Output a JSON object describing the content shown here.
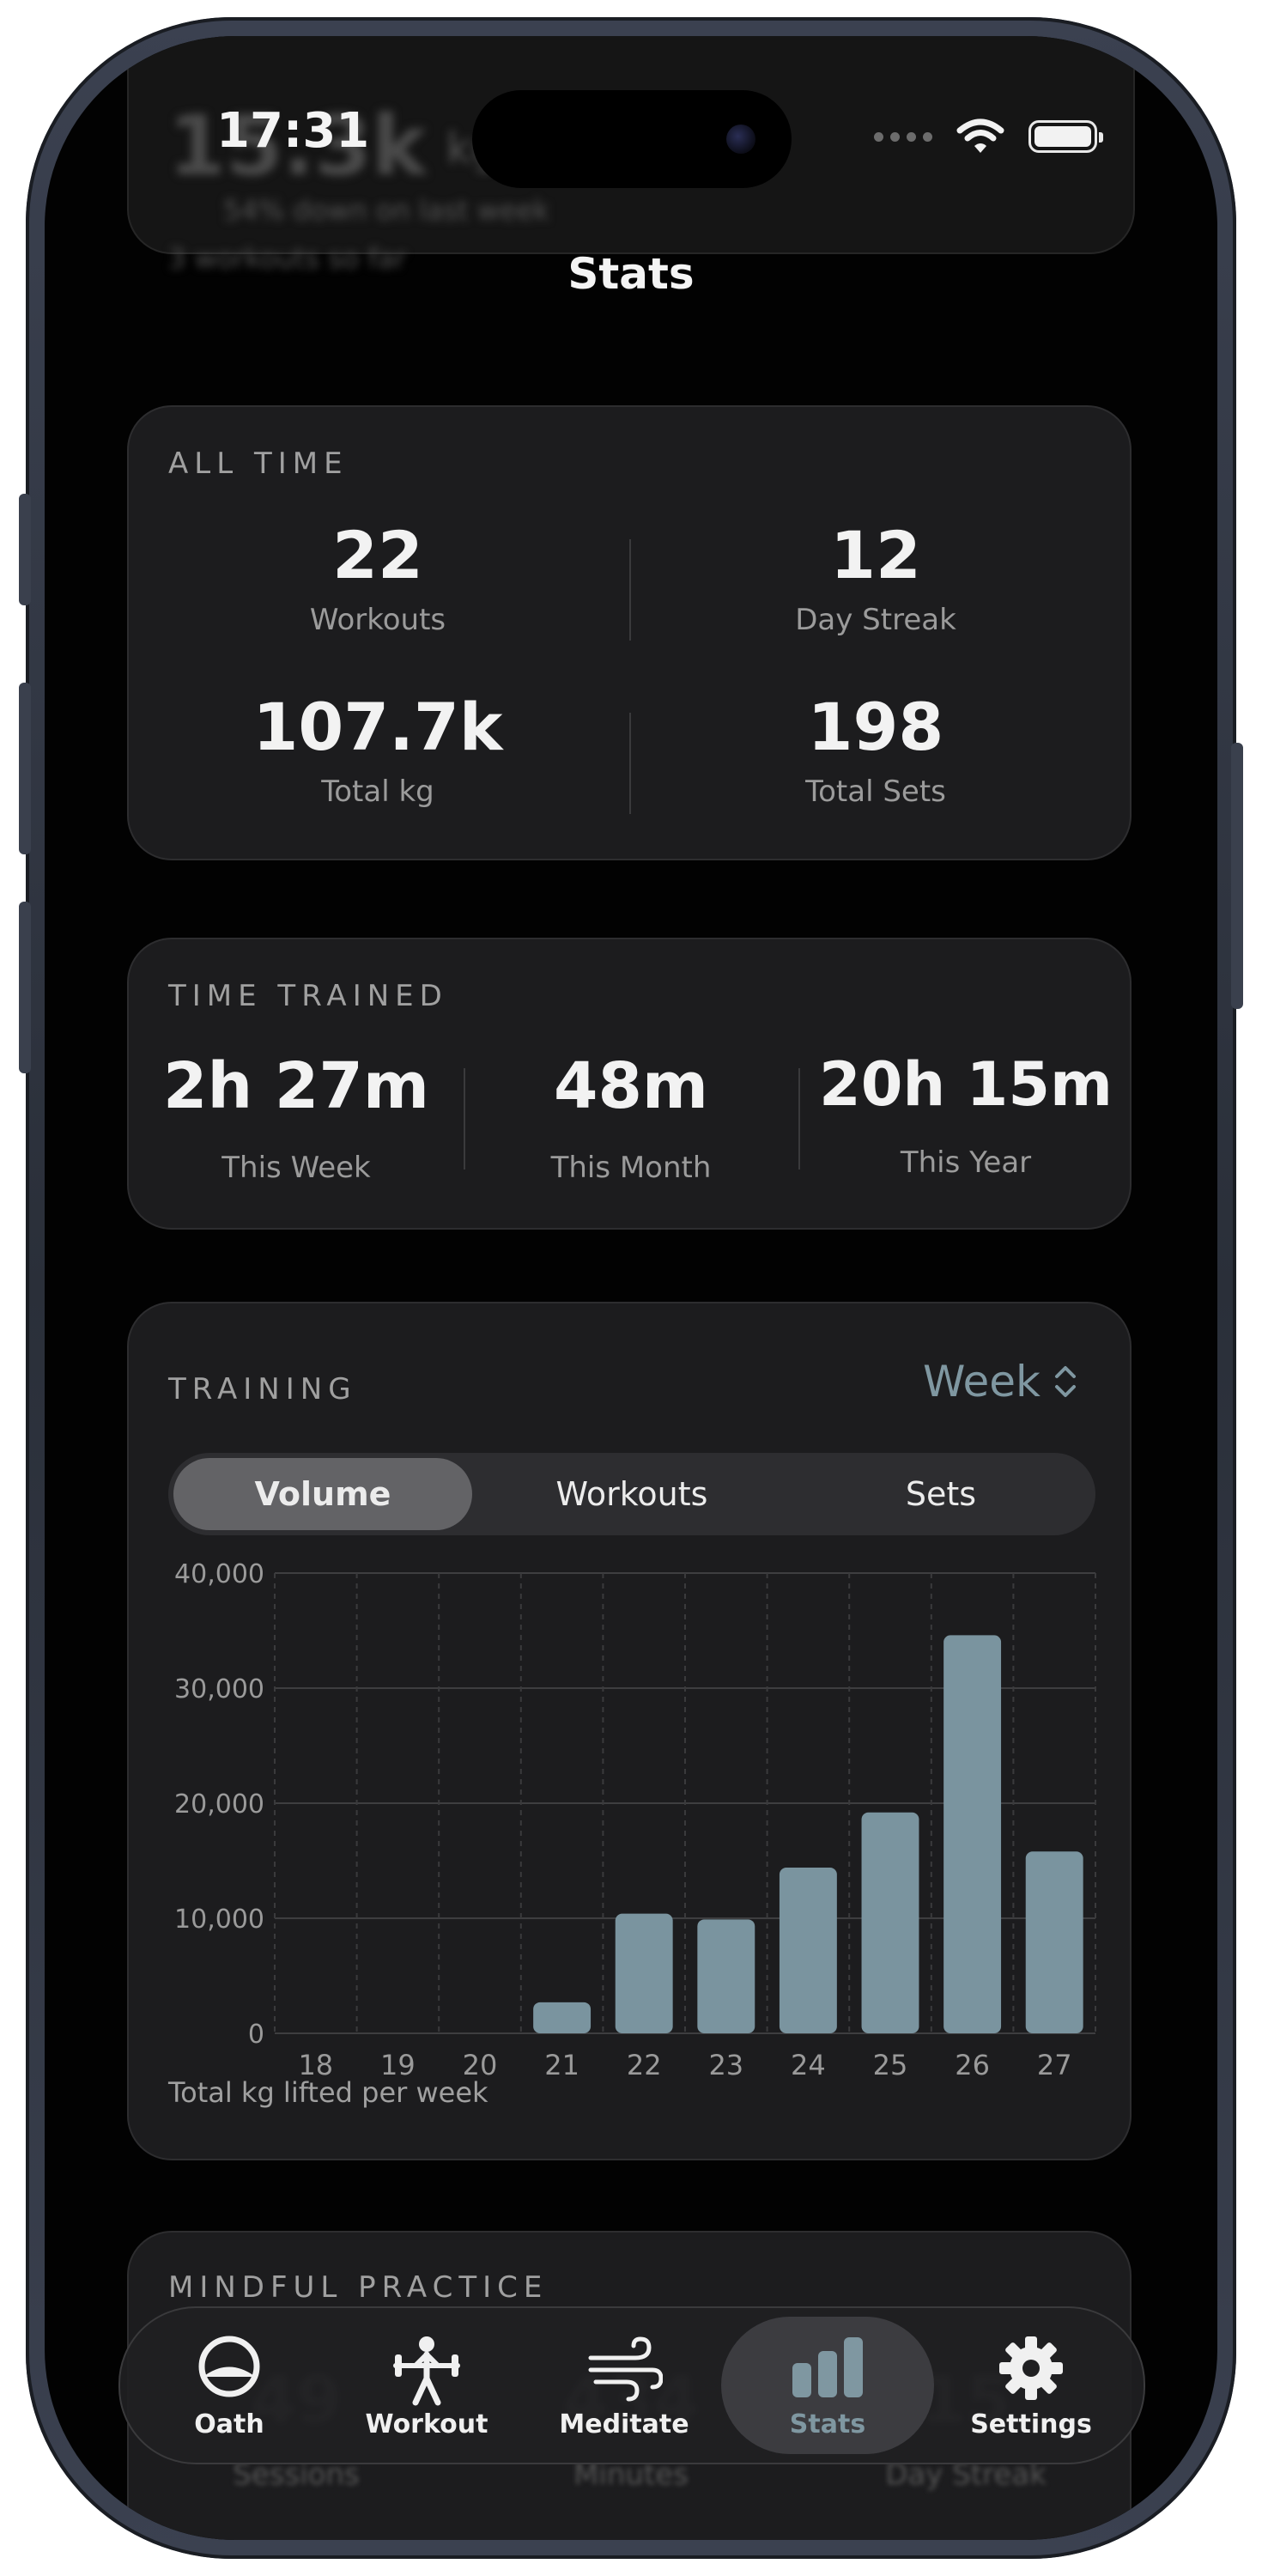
{
  "status_bar": {
    "time": "17:31"
  },
  "header": {
    "title": "Stats"
  },
  "ghost": {
    "value": "15.3k",
    "unit": "kg",
    "change": "54% down on last week",
    "workouts": "3 workouts so far"
  },
  "all_time": {
    "label": "ALL TIME",
    "workouts": {
      "value": "22",
      "label": "Workouts"
    },
    "streak": {
      "value": "12",
      "label": "Day Streak"
    },
    "total_kg": {
      "value": "107.7k",
      "label": "Total kg"
    },
    "total_sets": {
      "value": "198",
      "label": "Total Sets"
    }
  },
  "time_trained": {
    "label": "TIME TRAINED",
    "week": {
      "value": "2h 27m",
      "label": "This Week"
    },
    "month": {
      "value": "48m",
      "label": "This Month"
    },
    "year": {
      "value": "20h 15m",
      "label": "This Year"
    }
  },
  "training": {
    "label": "TRAINING",
    "period": "Week",
    "segments": [
      "Volume",
      "Workouts",
      "Sets"
    ],
    "active_segment": "Volume",
    "caption": "Total kg lifted per week"
  },
  "chart_data": {
    "type": "bar",
    "categories": [
      "18",
      "19",
      "20",
      "21",
      "22",
      "23",
      "24",
      "25",
      "26",
      "27"
    ],
    "values": [
      0,
      0,
      0,
      2700,
      10400,
      9900,
      14400,
      19200,
      34600,
      15800
    ],
    "y_ticks": [
      "0",
      "10,000",
      "20,000",
      "30,000",
      "40,000"
    ],
    "ylim": [
      0,
      40000
    ],
    "color": "#7a949f"
  },
  "mindful": {
    "label": "MINDFUL PRACTICE",
    "sessions": {
      "value": "49",
      "label": "Sessions"
    },
    "minutes": {
      "value": "434",
      "label": "Minutes"
    },
    "streak": {
      "value": "15",
      "label": "Day Streak"
    }
  },
  "tabbar": {
    "tabs": [
      {
        "label": "Oath",
        "icon": "oath-icon"
      },
      {
        "label": "Workout",
        "icon": "weightlifter-icon"
      },
      {
        "label": "Meditate",
        "icon": "wind-icon"
      },
      {
        "label": "Stats",
        "icon": "bar-chart-icon"
      },
      {
        "label": "Settings",
        "icon": "gear-icon"
      }
    ],
    "active": "Stats",
    "accent": "#7f97a1"
  }
}
